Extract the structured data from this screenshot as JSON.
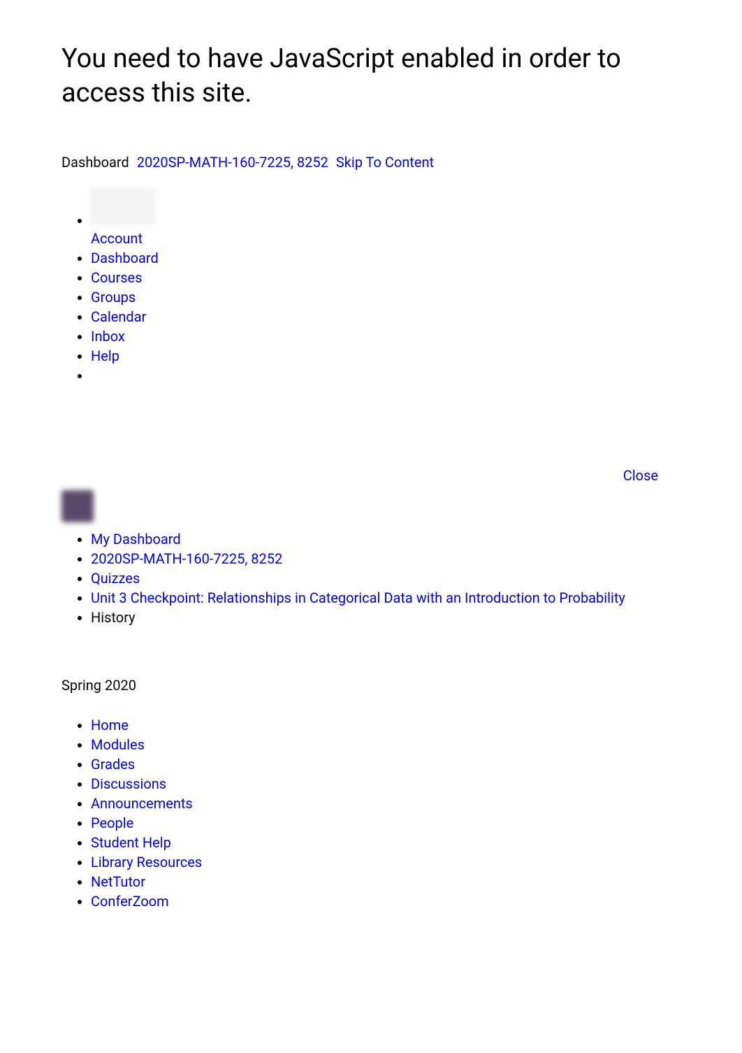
{
  "heading": "You need to have JavaScript enabled in order to access this site.",
  "topbar": {
    "dashboard_label": "Dashboard",
    "course_link": "2020SP-MATH-160-7225, 8252",
    "skip_link": "Skip To Content"
  },
  "global_nav": {
    "account": "Account",
    "dashboard": "Dashboard",
    "courses": "Courses",
    "groups": "Groups",
    "calendar": "Calendar",
    "inbox": "Inbox",
    "help": "Help"
  },
  "close_label": "Close",
  "breadcrumbs": {
    "my_dashboard": "My Dashboard",
    "course": "2020SP-MATH-160-7225, 8252",
    "quizzes": "Quizzes",
    "quiz_title": "Unit 3 Checkpoint: Relationships in Categorical Data with an Introduction to Probability",
    "history": "History"
  },
  "term": "Spring 2020",
  "course_nav": {
    "home": "Home",
    "modules": "Modules",
    "grades": "Grades",
    "discussions": "Discussions",
    "announcements": "Announcements",
    "people": "People",
    "student_help": "Student Help",
    "library_resources": "Library Resources",
    "nettutor": "NetTutor",
    "conferzoom": "ConferZoom"
  }
}
